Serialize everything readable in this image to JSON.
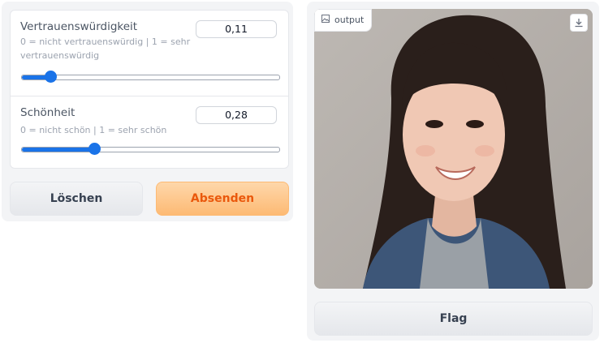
{
  "sliders": [
    {
      "label": "Vertrauenswürdigkeit",
      "info_line1": "0 = nicht vertrauenswürdig | 1 = sehr",
      "info_line2": "vertrauenswürdig",
      "value": "0,11",
      "level": 0.11
    },
    {
      "label": "Schönheit",
      "info": "0 = nicht schön | 1 = sehr schön",
      "value": "0,28",
      "level": 0.28
    }
  ],
  "buttons": {
    "clear": "Löschen",
    "submit": "Absenden",
    "flag": "Flag"
  },
  "output": {
    "label": "output",
    "image_icon": "image-icon",
    "download_icon": "download-icon"
  },
  "colors": {
    "accent": "#1a73e8",
    "submit_text": "#ea580c",
    "submit_bg": "#fdba74"
  }
}
